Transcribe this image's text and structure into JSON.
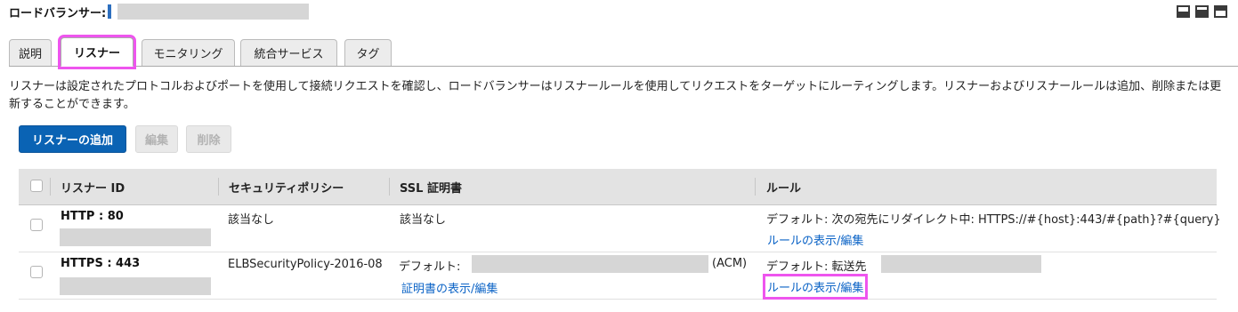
{
  "header": {
    "load_balancer_label": "ロードバランサー:"
  },
  "tabs": [
    {
      "label": "説明"
    },
    {
      "label": "リスナー"
    },
    {
      "label": "モニタリング"
    },
    {
      "label": "統合サービス"
    },
    {
      "label": "タグ"
    }
  ],
  "description": "リスナーは設定されたプロトコルおよびポートを使用して接続リクエストを確認し、ロードバランサーはリスナールールを使用してリクエストをターゲットにルーティングします。リスナーおよびリスナールールは追加、削除または更新することができます。",
  "actions": {
    "add_label": "リスナーの追加",
    "edit_label": "編集",
    "delete_label": "削除"
  },
  "table": {
    "columns": [
      "リスナー ID",
      "セキュリティポリシー",
      "SSL 証明書",
      "ルール"
    ],
    "rows": [
      {
        "listener_id": "HTTP : 80",
        "security_policy": "該当なし",
        "ssl_certificate": "該当なし",
        "rule_text": "デフォルト: 次の宛先にリダイレクト中: HTTPS://#{host}:443/#{path}?#{query}",
        "rule_link": "ルールの表示/編集"
      },
      {
        "listener_id": "HTTPS : 443",
        "security_policy": "ELBSecurityPolicy-2016-08",
        "ssl_prefix": "デフォルト:",
        "ssl_suffix": "(ACM)",
        "ssl_link": "証明書の表示/編集",
        "rule_text": "デフォルト: 転送先",
        "rule_link": "ルールの表示/編集"
      }
    ]
  },
  "colors": {
    "primary_button": "#0a63b4",
    "link": "#0b63c6",
    "highlight": "#ee55ee",
    "header_marker": "#2d6fbf"
  }
}
